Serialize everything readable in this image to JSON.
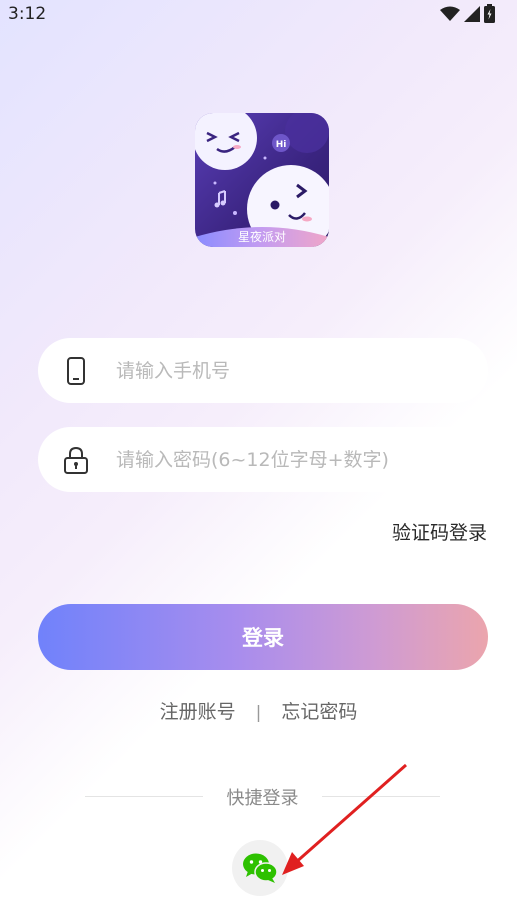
{
  "status_bar": {
    "time": "3:12"
  },
  "logo": {
    "text": "星夜派对",
    "bubble": "Hi"
  },
  "phone_field": {
    "placeholder": "请输入手机号"
  },
  "password_field": {
    "placeholder": "请输入密码(6~12位字母+数字)"
  },
  "code_login_label": "验证码登录",
  "login_button_label": "登录",
  "links": {
    "register": "注册账号",
    "separator": "|",
    "forgot": "忘记密码"
  },
  "quick_login": {
    "label": "快捷登录"
  },
  "colors": {
    "button_start": "#7082fb",
    "button_end": "#eba5ad",
    "wechat_green": "#2dc100",
    "arrow_red": "#e02020"
  },
  "icons": [
    "wifi-icon",
    "signal-icon",
    "battery-icon",
    "phone-icon",
    "lock-icon",
    "wechat-icon"
  ]
}
